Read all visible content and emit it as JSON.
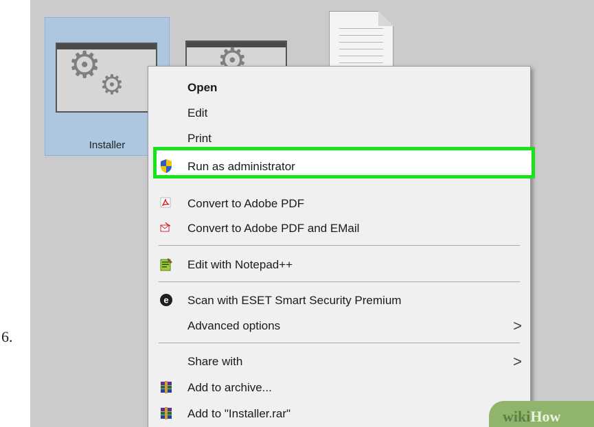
{
  "step_number": "6.",
  "desktop": {
    "selected_file": {
      "label": "Installer"
    }
  },
  "context_menu": {
    "items": [
      {
        "label": "Open",
        "bold": true
      },
      {
        "label": "Edit"
      },
      {
        "label": "Print"
      },
      {
        "label": "Run as administrator",
        "icon": "uac-shield-icon",
        "highlighted": true
      },
      {
        "label": "Convert to Adobe PDF",
        "icon": "adobe-pdf-icon"
      },
      {
        "label": "Convert to Adobe PDF and EMail",
        "icon": "adobe-pdf-email-icon"
      },
      {
        "label": "Edit with Notepad++",
        "icon": "notepad-plus-plus-icon"
      },
      {
        "label": "Scan with ESET Smart Security Premium",
        "icon": "eset-icon"
      },
      {
        "label": "Advanced options",
        "submenu": true
      },
      {
        "label": "Share with",
        "submenu": true
      },
      {
        "label": "Add to archive...",
        "icon": "winrar-icon"
      },
      {
        "label": "Add to \"Installer.rar\"",
        "icon": "winrar-icon"
      }
    ],
    "submenu_arrow": ">"
  },
  "highlight_color": "#18e21a",
  "watermark": {
    "part1": "wiki",
    "part2": "How"
  }
}
